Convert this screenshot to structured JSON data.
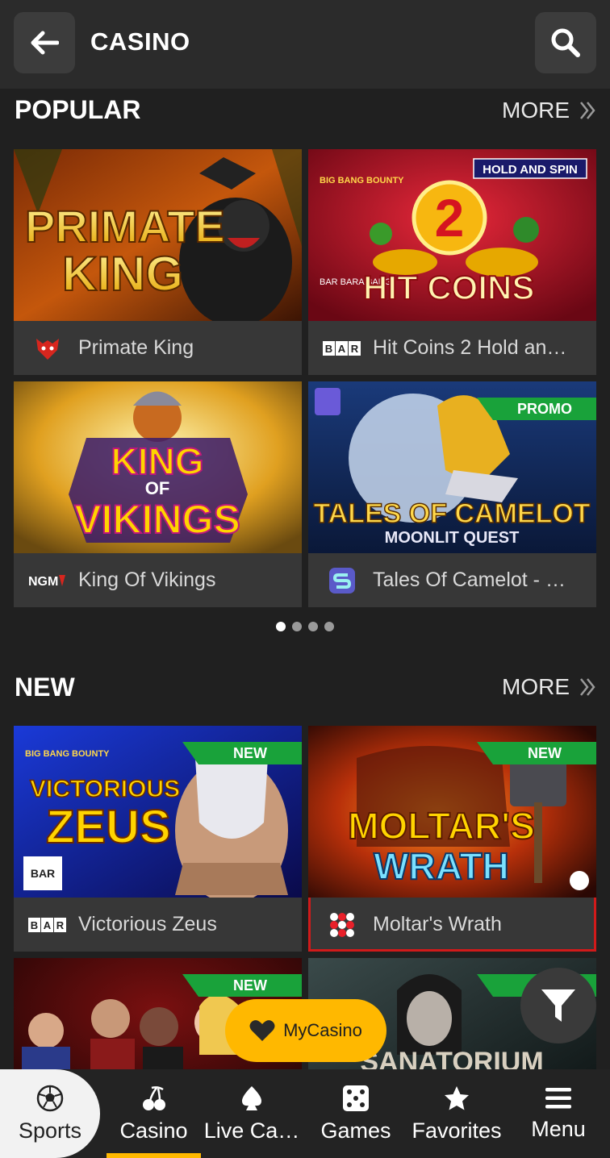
{
  "header": {
    "title": "CASINO"
  },
  "popular": {
    "title": "POPULAR",
    "more_label": "MORE",
    "games": [
      {
        "name": "Primate King",
        "art_title_1": "PRIMATE",
        "art_title_2": "KING"
      },
      {
        "name": "Hit Coins 2 Hold an…",
        "art_badge": "HOLD AND SPIN",
        "art_brand": "BIG BANG BOUNTY",
        "art_number": "2",
        "art_title": "HIT COINS",
        "art_provider": "BAR BARA BANG"
      },
      {
        "name": "King Of Vikings",
        "art_title_1": "KING",
        "art_title_2": "OF",
        "art_title_3": "VIKINGS"
      },
      {
        "name": "Tales Of Camelot - …",
        "ribbon": "PROMO",
        "art_title_1": "TALES OF CAMELOT",
        "art_title_2": "MOONLIT QUEST"
      }
    ]
  },
  "pagination": {
    "count": 4,
    "active": 1
  },
  "new_section": {
    "title": "NEW",
    "more_label": "MORE",
    "games": [
      {
        "name": "Victorious Zeus",
        "ribbon": "NEW",
        "art_brand": "BIG BANG BOUNTY",
        "art_title_1": "VICTORIOUS",
        "art_title_2": "ZEUS"
      },
      {
        "name": "Moltar's Wrath",
        "ribbon": "NEW",
        "art_title_1": "MOLTAR'S",
        "art_title_2": "WRATH"
      },
      {
        "name": "",
        "ribbon": "NEW"
      },
      {
        "name": "",
        "art_title_1": "SANATORIUM"
      }
    ]
  },
  "providers": {
    "bar": "BAR",
    "ngm": "NGM"
  },
  "mycasino_label": "MyCasino",
  "bottom_nav": [
    {
      "label": "Sports",
      "icon": "soccer-ball-icon"
    },
    {
      "label": "Casino",
      "icon": "cherries-icon",
      "active": true
    },
    {
      "label": "Live Ca…",
      "icon": "spade-icon"
    },
    {
      "label": "Games",
      "icon": "dice-icon"
    },
    {
      "label": "Favorites",
      "icon": "star-icon"
    },
    {
      "label": "Menu",
      "icon": "hamburger-icon"
    }
  ],
  "colors": {
    "accent": "#ffb800",
    "ribbon": "#19a23a",
    "background": "#202020"
  }
}
